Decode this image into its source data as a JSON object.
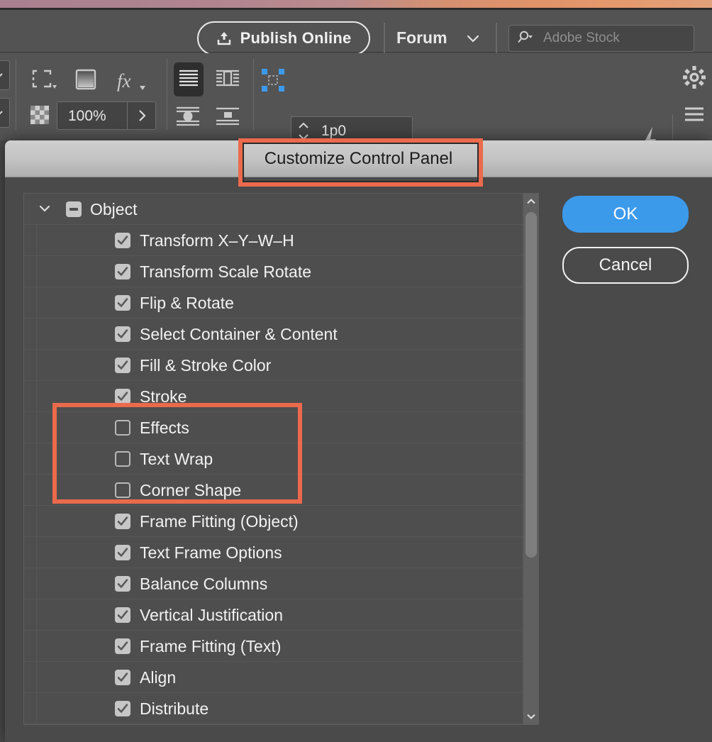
{
  "app": {
    "topbar": {
      "publish_label": "Publish Online",
      "publish_icon": "upload-icon",
      "forum_label": "Forum",
      "forum_caret_icon": "chevron-down-icon",
      "search_icon": "search-dropdown-icon",
      "search_placeholder": "Adobe Stock",
      "search_value": ""
    },
    "control_bar": {
      "icons": [
        {
          "name": "transform-reference-point-icon"
        },
        {
          "name": "drop-shadow-icon"
        },
        {
          "name": "fx-effects-icon"
        },
        {
          "name": "text-wrap-none-icon"
        },
        {
          "name": "text-wrap-object-shape-icon"
        },
        {
          "name": "frame-fitting-icon"
        },
        {
          "name": "align-center-vertical-icon"
        },
        {
          "name": "align-bottom-icon"
        },
        {
          "name": "quick-apply-icon"
        },
        {
          "name": "gear-icon"
        },
        {
          "name": "panel-menu-icon"
        }
      ],
      "opacity_value": "100%",
      "opacity_arrow": ">",
      "inset_value": "1p0",
      "stepper_icon": "stepper-up-down-icon",
      "dropdown_value": "",
      "dropdown_caret": "chevron-down-icon"
    }
  },
  "dialog": {
    "title": "Customize Control Panel",
    "ok_label": "OK",
    "cancel_label": "Cancel",
    "accent_color": "#3c9aeb",
    "annotation_color": "#ec6a4c",
    "scrollbar": {
      "up_arrow_icon": "chevron-up-icon",
      "down_arrow_icon": "chevron-down-icon"
    },
    "list": [
      {
        "type": "group",
        "label": "Object",
        "expanded": true,
        "state": "mixed",
        "twisty_icon": "chevron-down-icon"
      },
      {
        "type": "item",
        "label": "Transform X–Y–W–H",
        "checked": true
      },
      {
        "type": "item",
        "label": "Transform Scale Rotate",
        "checked": true
      },
      {
        "type": "item",
        "label": "Flip & Rotate",
        "checked": true
      },
      {
        "type": "item",
        "label": "Select Container & Content",
        "checked": true
      },
      {
        "type": "item",
        "label": "Fill & Stroke Color",
        "checked": true
      },
      {
        "type": "item",
        "label": "Stroke",
        "checked": true
      },
      {
        "type": "item",
        "label": "Effects",
        "checked": false
      },
      {
        "type": "item",
        "label": "Text Wrap",
        "checked": false
      },
      {
        "type": "item",
        "label": "Corner Shape",
        "checked": false
      },
      {
        "type": "item",
        "label": "Frame Fitting (Object)",
        "checked": true
      },
      {
        "type": "item",
        "label": "Text Frame Options",
        "checked": true
      },
      {
        "type": "item",
        "label": "Balance Columns",
        "checked": true
      },
      {
        "type": "item",
        "label": "Vertical Justification",
        "checked": true
      },
      {
        "type": "item",
        "label": "Frame Fitting (Text)",
        "checked": true
      },
      {
        "type": "item",
        "label": "Align",
        "checked": true
      },
      {
        "type": "item",
        "label": "Distribute",
        "checked": true
      }
    ]
  }
}
